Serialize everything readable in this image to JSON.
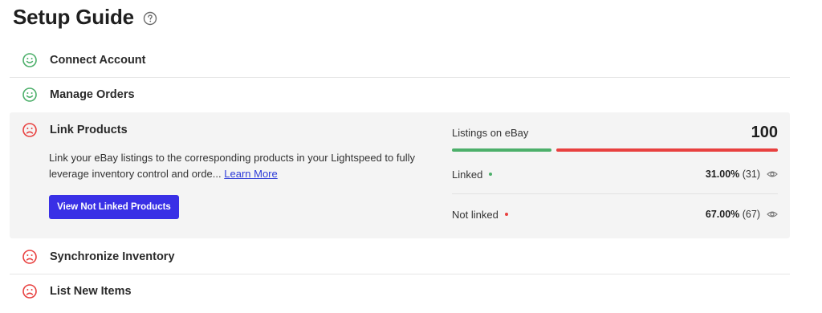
{
  "header": {
    "title": "Setup Guide",
    "help_icon": "question-circle-icon"
  },
  "colors": {
    "success": "#4caf6a",
    "error": "#e8403f",
    "primary": "#3930e6",
    "link": "#2d3bd8"
  },
  "steps": [
    {
      "label": "Connect Account",
      "status": "complete",
      "icon": "smiley-happy-icon"
    },
    {
      "label": "Manage Orders",
      "status": "complete",
      "icon": "smiley-happy-icon"
    },
    {
      "label": "Link Products",
      "status": "incomplete",
      "icon": "smiley-sad-icon",
      "description": "Link your eBay listings to the corresponding products in your Lightspeed to fully leverage inventory control and orde...",
      "learn_more": "Learn More",
      "button": "View Not Linked Products",
      "stats": {
        "label": "Listings on eBay",
        "total": "100",
        "linked_fraction": 0.31,
        "rows": [
          {
            "name": "Linked",
            "percent": "31.00%",
            "count": "(31)",
            "dot_color": "#4caf6a"
          },
          {
            "name": "Not linked",
            "percent": "67.00%",
            "count": "(67)",
            "dot_color": "#e8403f"
          }
        ]
      }
    },
    {
      "label": "Synchronize Inventory",
      "status": "incomplete",
      "icon": "smiley-sad-icon"
    },
    {
      "label": "List New Items",
      "status": "incomplete",
      "icon": "smiley-sad-icon"
    }
  ]
}
